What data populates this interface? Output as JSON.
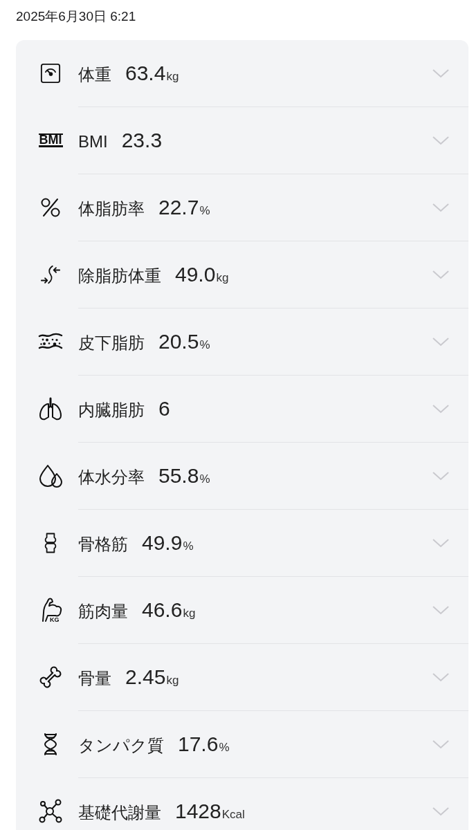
{
  "header": {
    "datetime": "2025年6月30日 6:21"
  },
  "metrics": [
    {
      "label": "体重",
      "value": "63.4",
      "unit": "kg"
    },
    {
      "label": "BMI",
      "value": "23.3",
      "icon_text": "BMI"
    },
    {
      "label": "体脂肪率",
      "value": "22.7",
      "unit": "%"
    },
    {
      "label": "除脂肪体重",
      "value": "49.0",
      "unit": "kg"
    },
    {
      "label": "皮下脂肪",
      "value": "20.5",
      "unit": "%"
    },
    {
      "label": "内臓脂肪",
      "value": "6"
    },
    {
      "label": "体水分率",
      "value": "55.8",
      "unit": "%"
    },
    {
      "label": "骨格筋",
      "value": "49.9",
      "unit": "%"
    },
    {
      "label": "筋肉量",
      "value": "46.6",
      "unit": "kg",
      "icon_text": "KG"
    },
    {
      "label": "骨量",
      "value": "2.45",
      "unit": "kg"
    },
    {
      "label": "タンパク質",
      "value": "17.6",
      "unit": "%"
    },
    {
      "label": "基礎代謝量",
      "value": "1428",
      "unit": "Kcal"
    }
  ]
}
